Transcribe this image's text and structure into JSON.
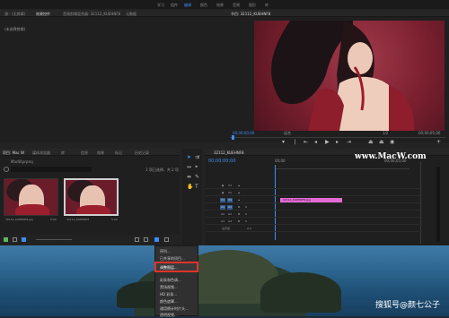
{
  "workspace_tabs": [
    "学习",
    "组件",
    "编辑",
    "颜色",
    "效果",
    "音频",
    "图形",
    "库"
  ],
  "workspace_active_index": 2,
  "source_panel": {
    "tabs": [
      "源：(无剪辑)",
      "效果控件",
      "音频剪辑混合器: 32112_KUEHNF8",
      "元数据"
    ],
    "body_text": "(未选择剪辑)"
  },
  "program_monitor": {
    "title": "节目: 32112_KUEHNF8",
    "timecode_left": "00;00;00;00",
    "fit_label": "适合",
    "quality_label": "1/2",
    "timecode_right": "00;00;05;00"
  },
  "project_panel": {
    "tabs": [
      "项目: Mac W",
      "媒体浏览器",
      "库",
      "信息",
      "效果",
      "标记",
      "历史记录"
    ],
    "project_name": "MacW.prproj",
    "item_count": "1 项已选择，共 2 项",
    "items": [
      {
        "name": "32112_KUEHNF8.jpg",
        "duration": "5;00"
      },
      {
        "name": "32112_KUEHNF8",
        "duration": "5;00"
      }
    ]
  },
  "timeline": {
    "tab": "32112_KUEHNF8",
    "timecode": "00;00;00;00",
    "ruler_start": "00;00",
    "ruler_end": "00;00;05;00",
    "tracks": [
      "V3",
      "V2",
      "V1",
      "A1",
      "A2",
      "A3"
    ],
    "master_label": "主声道",
    "master_value": "0.0",
    "clip_label": "32112_KUEHNF8.jpg"
  },
  "context_menu": {
    "items": [
      "序列...",
      "已共享的项目...",
      "脱机文件...",
      "调整图层...",
      "彩条和色调...",
      "黑场视频...",
      "HD 彩条...",
      "颜色遮罩...",
      "通用倒计时片头...",
      "透明视频..."
    ],
    "highlight_index": 3
  },
  "watermark": {
    "site": "www.MacW.com",
    "source": "搜狐号@颜七公子"
  }
}
